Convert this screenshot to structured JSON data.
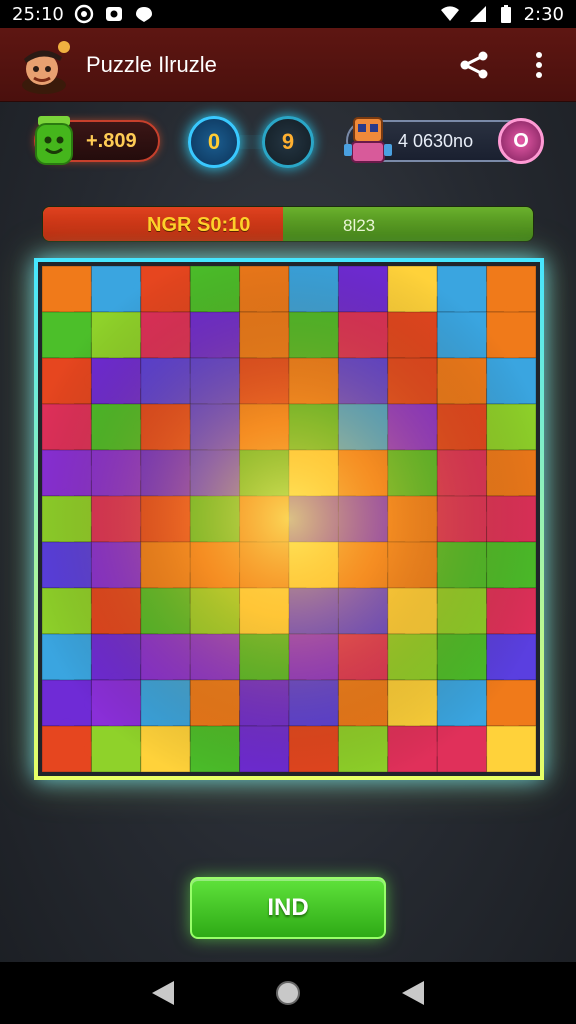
{
  "status_bar": {
    "time_left": "25:10",
    "time_right": "2:30",
    "icons_left": [
      "sync-icon",
      "camera-icon",
      "drop-icon"
    ],
    "icons_right": [
      "wifi-icon",
      "signal-icon",
      "battery-icon"
    ]
  },
  "app_bar": {
    "title": "Puzzle Ilruzle",
    "actions": [
      "share-icon",
      "more-vert-icon"
    ]
  },
  "hud": {
    "left_value": "+.809",
    "coin_a": "0",
    "coin_b": "9",
    "right_value": "4 0630no",
    "right_badge": "O"
  },
  "progress": {
    "label": "NGR S0:10",
    "value": "8l23",
    "fraction": 0.49,
    "fill_color": "#d23517",
    "track_color": "#57a224"
  },
  "board": {
    "rows": 11,
    "cols": 10,
    "palette": [
      "#6f2bd6",
      "#e6461f",
      "#4cbf2a",
      "#8a2fd8",
      "#f07a1a",
      "#3aa5e0",
      "#e0305a",
      "#8fd22a",
      "#ffd23a",
      "#5a3fe0"
    ]
  },
  "play_button": {
    "label": "IND"
  },
  "nav_bar": {
    "buttons": [
      "back-icon",
      "home-icon",
      "recents-icon"
    ]
  }
}
